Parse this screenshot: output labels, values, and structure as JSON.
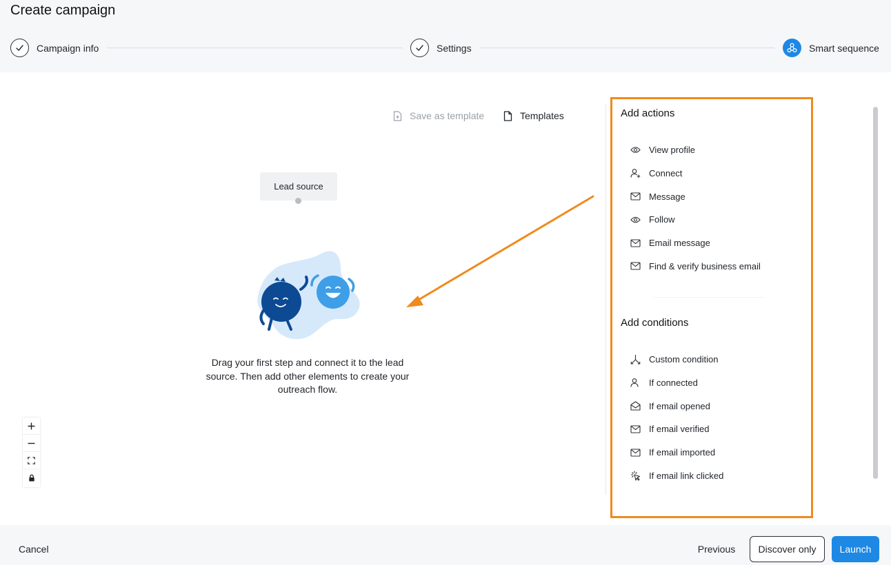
{
  "page": {
    "title": "Create campaign"
  },
  "stepper": {
    "steps": [
      {
        "label": "Campaign info",
        "state": "completed"
      },
      {
        "label": "Settings",
        "state": "completed"
      },
      {
        "label": "Smart sequence",
        "state": "active"
      }
    ]
  },
  "toolbar": {
    "save_template": "Save as template",
    "templates": "Templates"
  },
  "canvas": {
    "lead_source": "Lead source",
    "empty_state": "Drag your first step and connect it to the lead source. Then add other elements to create your outreach flow."
  },
  "actions_panel": {
    "actions_heading": "Add actions",
    "actions": [
      {
        "label": "View profile",
        "icon": "eye-icon"
      },
      {
        "label": "Connect",
        "icon": "user-plus-icon"
      },
      {
        "label": "Message",
        "icon": "mail-icon"
      },
      {
        "label": "Follow",
        "icon": "eye-plus-icon"
      },
      {
        "label": "Email message",
        "icon": "mail-icon"
      },
      {
        "label": "Find & verify business email",
        "icon": "mail-icon"
      }
    ],
    "conditions_heading": "Add conditions",
    "conditions": [
      {
        "label": "Custom condition",
        "icon": "branch-icon"
      },
      {
        "label": "If connected",
        "icon": "user-icon"
      },
      {
        "label": "If email opened",
        "icon": "mail-open-icon"
      },
      {
        "label": "If email verified",
        "icon": "mail-icon"
      },
      {
        "label": "If email imported",
        "icon": "mail-icon"
      },
      {
        "label": "If email link clicked",
        "icon": "click-icon"
      }
    ]
  },
  "footer": {
    "cancel": "Cancel",
    "previous": "Previous",
    "discover_only": "Discover only",
    "launch": "Launch"
  },
  "colors": {
    "accent": "#1e88e5",
    "highlight": "#f08a1c",
    "illustration_dark": "#0d4a94",
    "illustration_light": "#3f9ee8",
    "illustration_blob": "#d6e9fb"
  }
}
